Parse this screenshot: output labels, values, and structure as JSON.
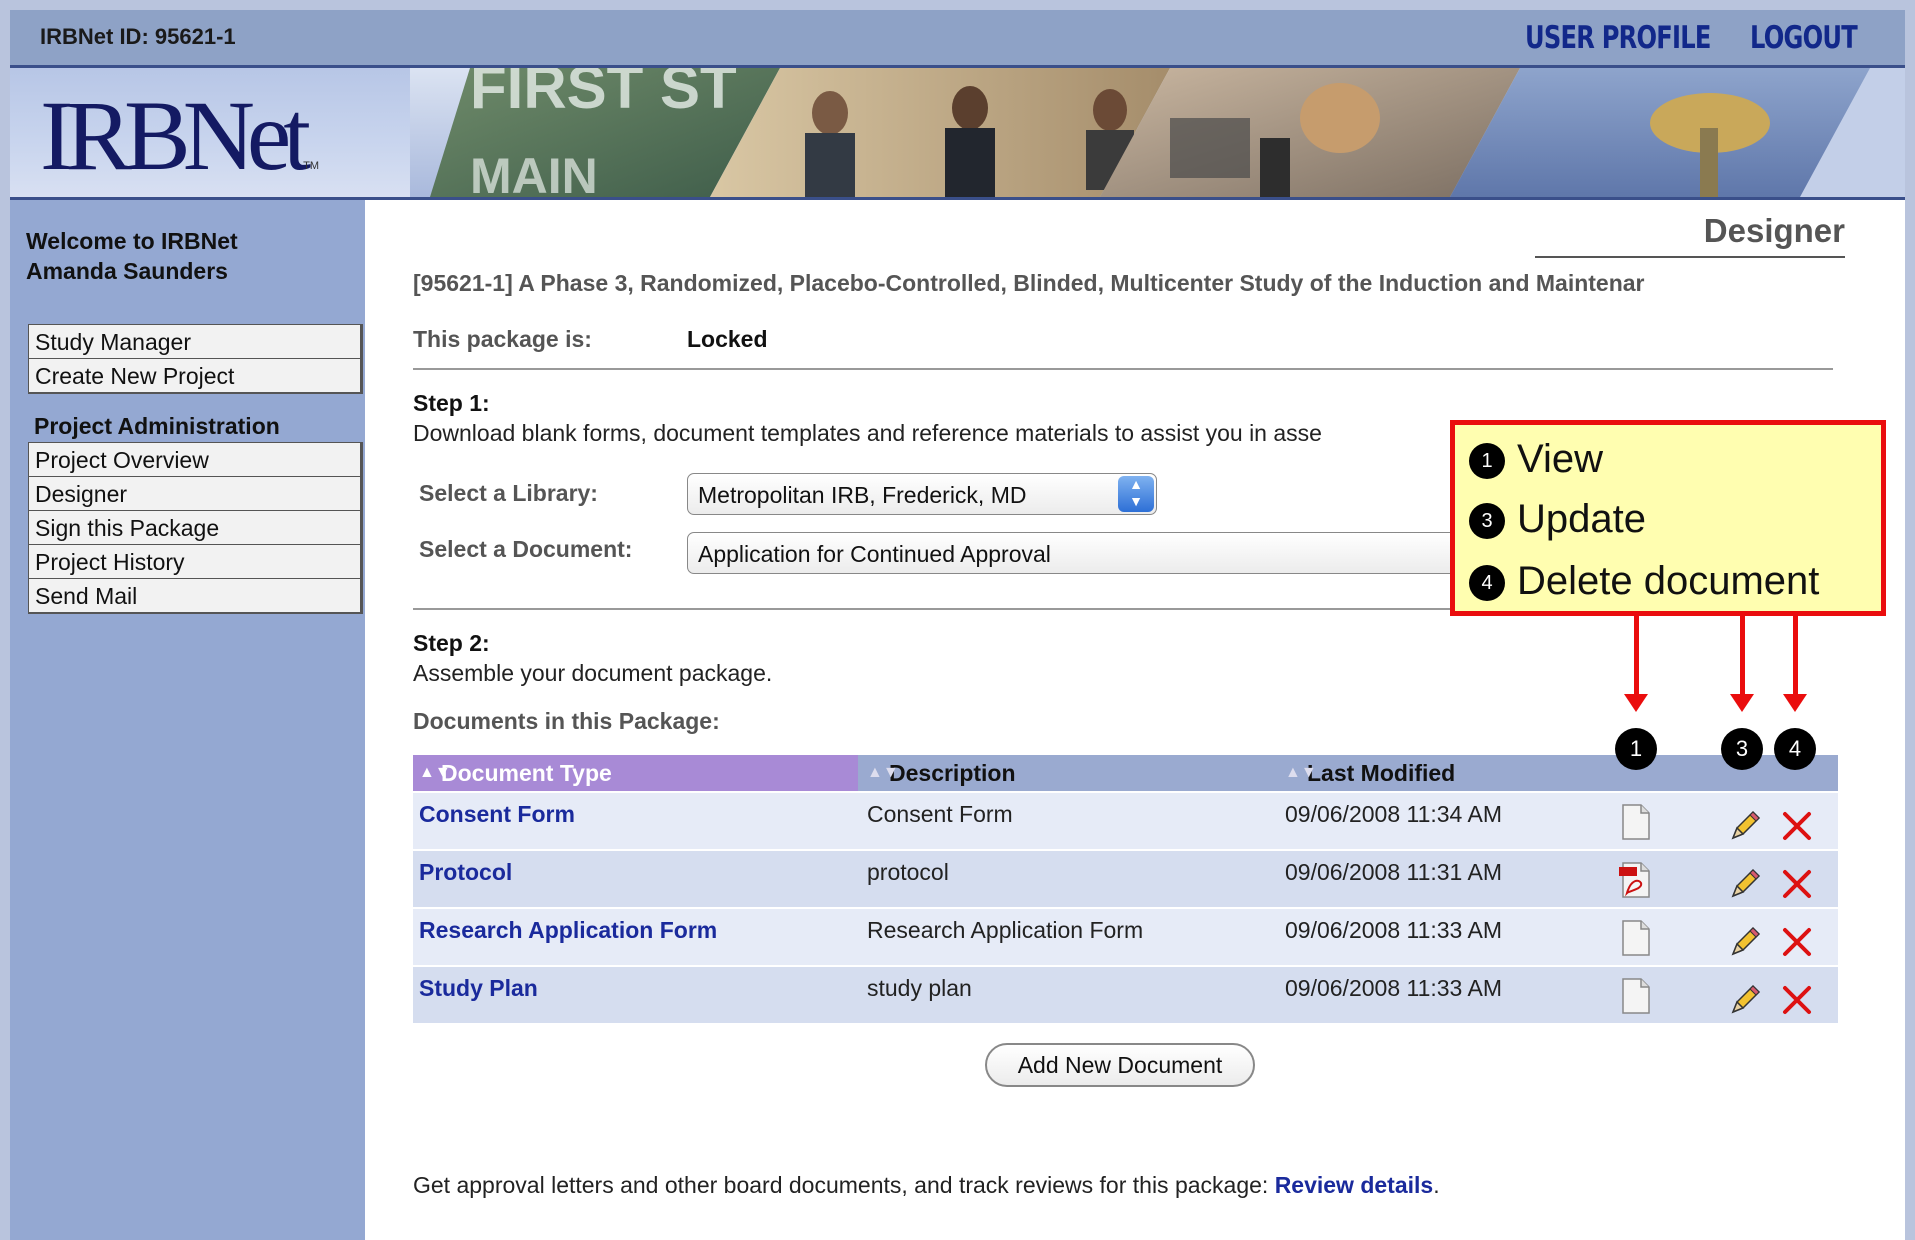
{
  "header": {
    "irbnet_id": "IRBNet ID: 95621-1",
    "user_profile": "USER PROFILE",
    "logout": "LOGOUT"
  },
  "banner": {
    "logo_text": "IRBNet",
    "logo_tm": "TM"
  },
  "sidebar": {
    "welcome_line1": "Welcome to IRBNet",
    "welcome_line2": "Amanda Saunders",
    "nav_top": [
      "Study Manager",
      "Create New Project"
    ],
    "section_header": "Project Administration",
    "nav_project": [
      "Project Overview",
      "Designer",
      "Sign this Package",
      "Project History",
      "Send Mail"
    ]
  },
  "main": {
    "page_title": "Designer",
    "study_title": "[95621-1] A Phase 3, Randomized, Placebo-Controlled, Blinded, Multicenter Study of the Induction and Maintenar",
    "package_label": "This package is:",
    "package_status": "Locked",
    "step1_label": "Step 1:",
    "step1_text": "Download blank forms, document templates and reference materials to assist you in asse",
    "library_label": "Select a Library:",
    "library_value": "Metropolitan IRB, Frederick, MD",
    "document_label": "Select a Document:",
    "document_value": "Application for Continued Approval",
    "step2_label": "Step 2:",
    "step2_text": "Assemble your document package.",
    "docs_label": "Documents in this Package:",
    "table": {
      "headers": [
        "Document Type",
        "Description",
        "Last Modified"
      ],
      "rows": [
        {
          "type": "Consent Form",
          "description": "Consent Form",
          "modified": "09/06/2008 11:34 AM",
          "file_icon": "blank-document-icon"
        },
        {
          "type": "Protocol",
          "description": "protocol",
          "modified": "09/06/2008 11:31 AM",
          "file_icon": "pdf-document-icon"
        },
        {
          "type": "Research Application Form",
          "description": "Research Application Form",
          "modified": "09/06/2008 11:33 AM",
          "file_icon": "blank-document-icon"
        },
        {
          "type": "Study Plan",
          "description": "study plan",
          "modified": "09/06/2008 11:33 AM",
          "file_icon": "blank-document-icon"
        }
      ]
    },
    "add_button": "Add New Document",
    "review_text": "Get approval letters and other board documents, and track reviews for this package: ",
    "review_link": "Review details",
    "review_period": "."
  },
  "callout": {
    "items": [
      {
        "num": "1",
        "label": "View"
      },
      {
        "num": "3",
        "label": "Update"
      },
      {
        "num": "4",
        "label": "Delete document"
      }
    ],
    "column_markers": [
      "1",
      "3",
      "4"
    ],
    "border_color": "#ea0d0d",
    "fill_color": "#fffeb0"
  },
  "colors": {
    "nav_bg": "#94a8d2",
    "link": "#1a2a9c",
    "header_accent": "#a88ad6"
  }
}
